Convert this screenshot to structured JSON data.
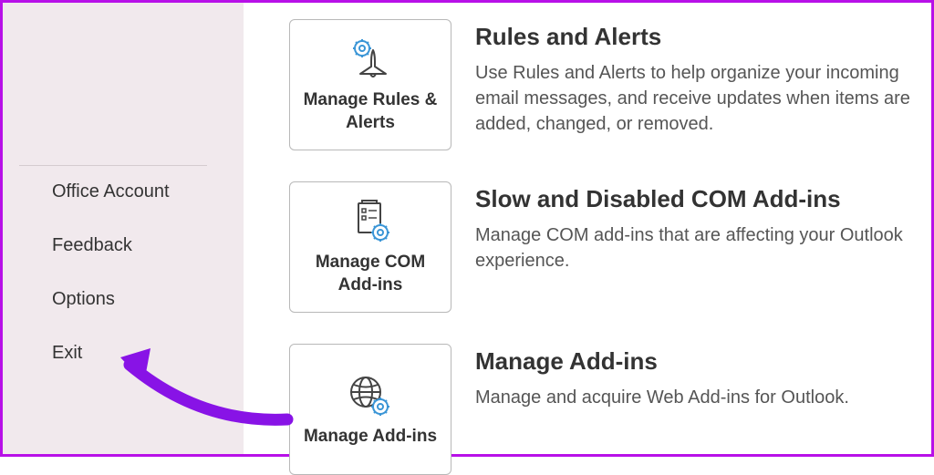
{
  "sidebar": {
    "items": [
      {
        "label": "Office Account"
      },
      {
        "label": "Feedback"
      },
      {
        "label": "Options"
      },
      {
        "label": "Exit"
      }
    ]
  },
  "sections": [
    {
      "card_label": "Manage Rules & Alerts",
      "title": "Rules and Alerts",
      "desc": "Use Rules and Alerts to help organize your incoming email messages, and receive updates when items are added, changed, or removed."
    },
    {
      "card_label": "Manage COM Add-ins",
      "title": "Slow and Disabled COM Add-ins",
      "desc": "Manage COM add-ins that are affecting your Outlook experience."
    },
    {
      "card_label": "Manage Add-ins",
      "title": "Manage Add-ins",
      "desc": "Manage and acquire Web Add-ins for Outlook."
    }
  ]
}
